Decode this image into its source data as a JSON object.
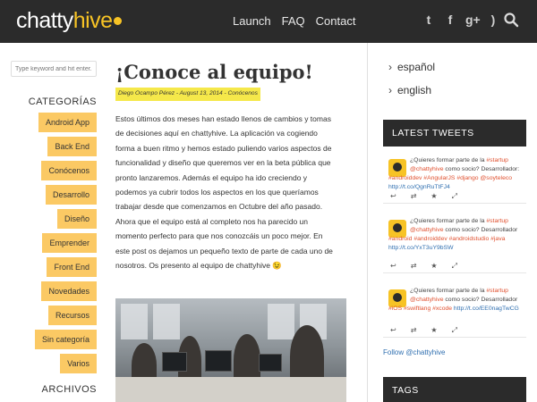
{
  "header": {
    "logo_text": "chatty",
    "logo_accent": "hive",
    "nav": [
      "Launch",
      "FAQ",
      "Contact"
    ],
    "social_icons": [
      "twitter-icon",
      "facebook-icon",
      "google-plus-icon",
      "rss-icon"
    ],
    "social_glyphs": [
      "t",
      "f",
      "g+",
      ")"
    ]
  },
  "sidebar_left": {
    "search_placeholder": "Type keyword and hit enter...",
    "categories_title": "CATEGORÍAS",
    "categories": [
      "Android App",
      "Back End",
      "Conócenos",
      "Desarrollo",
      "Diseño",
      "Emprender",
      "Front End",
      "Novedades",
      "Recursos",
      "Sin categoría",
      "Varios"
    ],
    "archives_title": "ARCHIVOS"
  },
  "post": {
    "title": "¡Conoce al equipo!",
    "meta": "Diego Ocampo Pérez - August 13, 2014 - Conócenos",
    "body": "Estos últimos dos meses han estado llenos de cambios y tomas de decisiones aquí en chattyhive. La aplicación va cogiendo forma a buen ritmo y hemos estado puliendo varios aspectos de funcionalidad y diseño que queremos ver en la beta pública que pronto lanzaremos. Además el equipo ha ido creciendo y podemos ya cubrir todos los aspectos en los que queríamos trabajar desde que comenzamos en Octubre del año pasado. Ahora que el equipo está al completo nos ha parecido un momento perfecto para que nos conozcáis un poco mejor. En este post os dejamos un pequeño texto de parte de cada uno de nosotros. Os presento al equipo de chattyhive 😉"
  },
  "sidebar_right": {
    "languages": [
      "español",
      "english"
    ],
    "tweets_title": "LATEST TWEETS",
    "tweets": [
      {
        "intro": "¿Quieres formar parte de la",
        "tags1": "#startup",
        "mid": "@chattyhive",
        "mid2": "como socio? Desarrollador:",
        "tags2": "#androiddev #AngularJS #django @soyteleco",
        "link": "http://t.co/QgnRuTtFJ4"
      },
      {
        "intro": "¿Quieres formar parte de la",
        "tags1": "#startup",
        "mid": "@chattyhive",
        "mid2": "como socio? Desarrollador",
        "tags2": "#android #androiddev #androidstudio #java",
        "link": "http://t.co/YxT3uY9bSW"
      },
      {
        "intro": "¿Quieres formar parte de la",
        "tags1": "#startup",
        "mid": "@chattyhive",
        "mid2": "como socio? Desarrollador",
        "tags2": "#iOS #swiftlang #xcode",
        "link": "http://t.co/EE0nagTwCG"
      }
    ],
    "tweet_actions": [
      "↩",
      "⇄",
      "★",
      "⤢"
    ],
    "follow_text": "Follow @chattyhive",
    "tags_title": "TAGS"
  }
}
